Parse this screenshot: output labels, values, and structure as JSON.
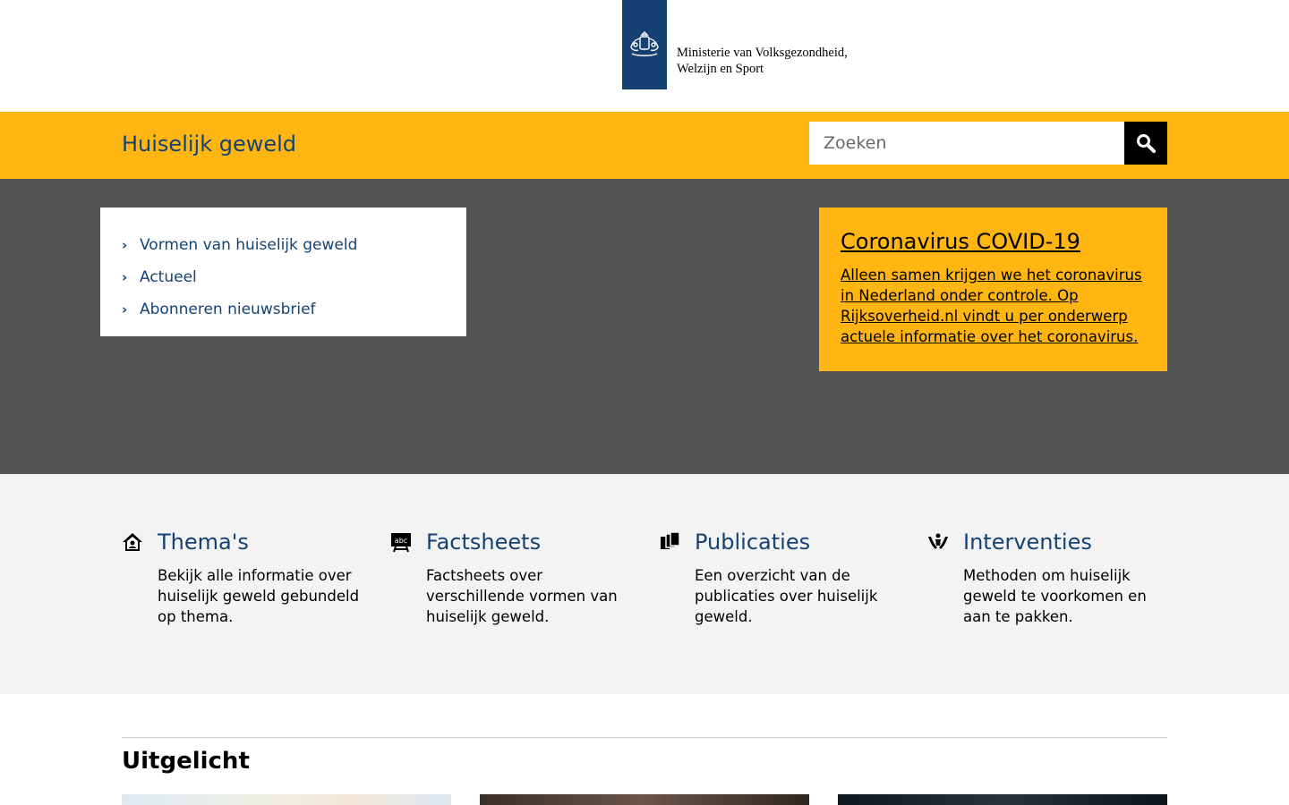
{
  "header": {
    "ministry_line1": "Ministerie van Volksgezondheid,",
    "ministry_line2": "Welzijn en Sport",
    "logo_color": "#154273"
  },
  "topbar": {
    "site_title": "Huiselijk geweld",
    "search_placeholder": "Zoeken",
    "accent": "#ffb612",
    "search_icon": "search-icon"
  },
  "nav": {
    "items": [
      {
        "label": "Vormen van huiselijk geweld"
      },
      {
        "label": "Actueel"
      },
      {
        "label": "Abonneren nieuwsbrief"
      }
    ]
  },
  "corona": {
    "title": "Coronavirus COVID-19",
    "text": "Alleen samen krijgen we het coronavirus in Nederland onder controle. Op Rijksoverheid.nl vindt u per onderwerp actuele informatie over het coronavirus."
  },
  "tiles": [
    {
      "icon": "house-icon",
      "title": "Thema's",
      "desc": "Bekijk alle informatie over huiselijk geweld gebundeld op thema."
    },
    {
      "icon": "chalkboard-icon",
      "title": "Factsheets",
      "desc": "Factsheets over verschillende vormen van huiselijk geweld."
    },
    {
      "icon": "documents-icon",
      "title": "Publicaties",
      "desc": "Een overzicht van de publicaties over huiselijk geweld."
    },
    {
      "icon": "hands-icon",
      "title": "Interventies",
      "desc": "Methoden om huiselijk geweld te voorkomen en aan te pakken."
    }
  ],
  "featured": {
    "heading": "Uitgelicht"
  }
}
